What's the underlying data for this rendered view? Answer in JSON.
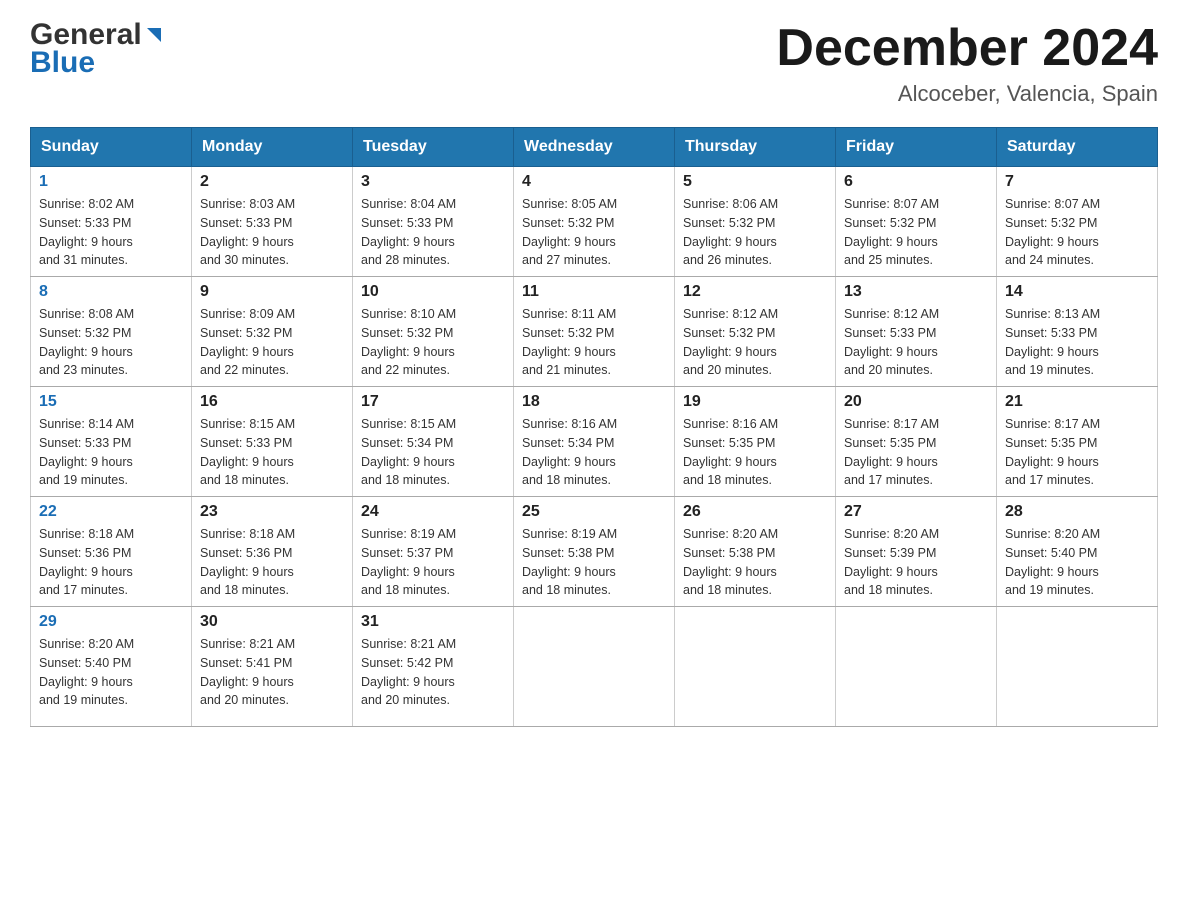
{
  "header": {
    "logo": {
      "line1": "General",
      "line2": "Blue"
    },
    "month_title": "December 2024",
    "location": "Alcoceber, Valencia, Spain"
  },
  "weekdays": [
    "Sunday",
    "Monday",
    "Tuesday",
    "Wednesday",
    "Thursday",
    "Friday",
    "Saturday"
  ],
  "weeks": [
    [
      {
        "date": "1",
        "sunrise": "8:02 AM",
        "sunset": "5:33 PM",
        "daylight": "9 hours and 31 minutes."
      },
      {
        "date": "2",
        "sunrise": "8:03 AM",
        "sunset": "5:33 PM",
        "daylight": "9 hours and 30 minutes."
      },
      {
        "date": "3",
        "sunrise": "8:04 AM",
        "sunset": "5:33 PM",
        "daylight": "9 hours and 28 minutes."
      },
      {
        "date": "4",
        "sunrise": "8:05 AM",
        "sunset": "5:32 PM",
        "daylight": "9 hours and 27 minutes."
      },
      {
        "date": "5",
        "sunrise": "8:06 AM",
        "sunset": "5:32 PM",
        "daylight": "9 hours and 26 minutes."
      },
      {
        "date": "6",
        "sunrise": "8:07 AM",
        "sunset": "5:32 PM",
        "daylight": "9 hours and 25 minutes."
      },
      {
        "date": "7",
        "sunrise": "8:07 AM",
        "sunset": "5:32 PM",
        "daylight": "9 hours and 24 minutes."
      }
    ],
    [
      {
        "date": "8",
        "sunrise": "8:08 AM",
        "sunset": "5:32 PM",
        "daylight": "9 hours and 23 minutes."
      },
      {
        "date": "9",
        "sunrise": "8:09 AM",
        "sunset": "5:32 PM",
        "daylight": "9 hours and 22 minutes."
      },
      {
        "date": "10",
        "sunrise": "8:10 AM",
        "sunset": "5:32 PM",
        "daylight": "9 hours and 22 minutes."
      },
      {
        "date": "11",
        "sunrise": "8:11 AM",
        "sunset": "5:32 PM",
        "daylight": "9 hours and 21 minutes."
      },
      {
        "date": "12",
        "sunrise": "8:12 AM",
        "sunset": "5:32 PM",
        "daylight": "9 hours and 20 minutes."
      },
      {
        "date": "13",
        "sunrise": "8:12 AM",
        "sunset": "5:33 PM",
        "daylight": "9 hours and 20 minutes."
      },
      {
        "date": "14",
        "sunrise": "8:13 AM",
        "sunset": "5:33 PM",
        "daylight": "9 hours and 19 minutes."
      }
    ],
    [
      {
        "date": "15",
        "sunrise": "8:14 AM",
        "sunset": "5:33 PM",
        "daylight": "9 hours and 19 minutes."
      },
      {
        "date": "16",
        "sunrise": "8:15 AM",
        "sunset": "5:33 PM",
        "daylight": "9 hours and 18 minutes."
      },
      {
        "date": "17",
        "sunrise": "8:15 AM",
        "sunset": "5:34 PM",
        "daylight": "9 hours and 18 minutes."
      },
      {
        "date": "18",
        "sunrise": "8:16 AM",
        "sunset": "5:34 PM",
        "daylight": "9 hours and 18 minutes."
      },
      {
        "date": "19",
        "sunrise": "8:16 AM",
        "sunset": "5:35 PM",
        "daylight": "9 hours and 18 minutes."
      },
      {
        "date": "20",
        "sunrise": "8:17 AM",
        "sunset": "5:35 PM",
        "daylight": "9 hours and 17 minutes."
      },
      {
        "date": "21",
        "sunrise": "8:17 AM",
        "sunset": "5:35 PM",
        "daylight": "9 hours and 17 minutes."
      }
    ],
    [
      {
        "date": "22",
        "sunrise": "8:18 AM",
        "sunset": "5:36 PM",
        "daylight": "9 hours and 17 minutes."
      },
      {
        "date": "23",
        "sunrise": "8:18 AM",
        "sunset": "5:36 PM",
        "daylight": "9 hours and 18 minutes."
      },
      {
        "date": "24",
        "sunrise": "8:19 AM",
        "sunset": "5:37 PM",
        "daylight": "9 hours and 18 minutes."
      },
      {
        "date": "25",
        "sunrise": "8:19 AM",
        "sunset": "5:38 PM",
        "daylight": "9 hours and 18 minutes."
      },
      {
        "date": "26",
        "sunrise": "8:20 AM",
        "sunset": "5:38 PM",
        "daylight": "9 hours and 18 minutes."
      },
      {
        "date": "27",
        "sunrise": "8:20 AM",
        "sunset": "5:39 PM",
        "daylight": "9 hours and 18 minutes."
      },
      {
        "date": "28",
        "sunrise": "8:20 AM",
        "sunset": "5:40 PM",
        "daylight": "9 hours and 19 minutes."
      }
    ],
    [
      {
        "date": "29",
        "sunrise": "8:20 AM",
        "sunset": "5:40 PM",
        "daylight": "9 hours and 19 minutes."
      },
      {
        "date": "30",
        "sunrise": "8:21 AM",
        "sunset": "5:41 PM",
        "daylight": "9 hours and 20 minutes."
      },
      {
        "date": "31",
        "sunrise": "8:21 AM",
        "sunset": "5:42 PM",
        "daylight": "9 hours and 20 minutes."
      },
      null,
      null,
      null,
      null
    ]
  ],
  "labels": {
    "sunrise": "Sunrise:",
    "sunset": "Sunset:",
    "daylight": "Daylight:"
  }
}
